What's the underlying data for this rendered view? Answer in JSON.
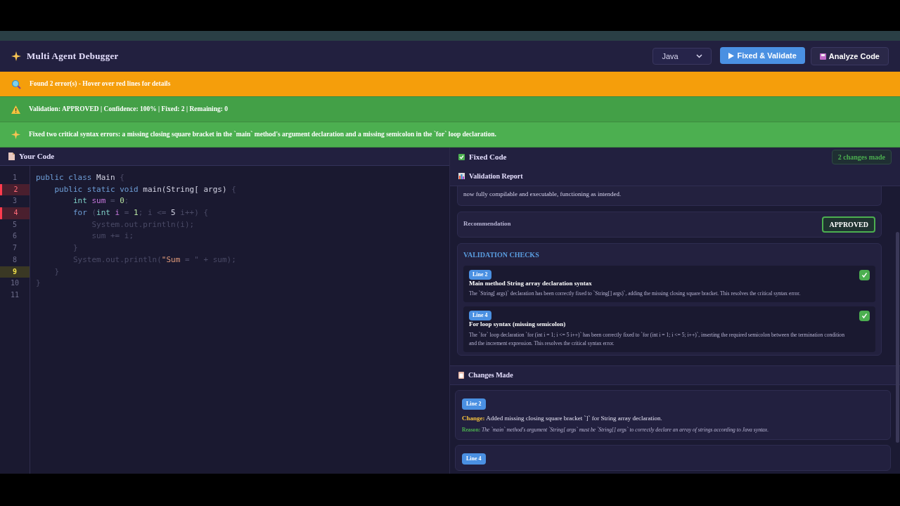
{
  "app": {
    "title": "Multi Agent Debugger"
  },
  "toolbar": {
    "language": "Java",
    "buttons": [
      {
        "kind": "primary",
        "label": "Fixed & Validate"
      },
      {
        "kind": "secondary",
        "label": "Analyze Code"
      }
    ]
  },
  "banners": [
    {
      "kind": "search",
      "color": "#f59e0b",
      "text": "Found 2 error(s) - Hover over red lines for details"
    },
    {
      "kind": "warning",
      "color": "#43a047",
      "text": "Validation: APPROVED | Confidence: 100% | Fixed: 2 | Remaining: 0"
    },
    {
      "kind": "sparkle",
      "color": "#4caf50",
      "text": "Fixed two critical syntax errors: a missing closing square bracket in the `main` method's argument declaration and a missing semicolon in the `for` loop declaration."
    }
  ],
  "editor": {
    "title": "Your Code",
    "lines": [
      {
        "number": "1",
        "error": false,
        "current": false,
        "tokens": [
          {
            "kind": "keyword",
            "text": "public class "
          },
          {
            "kind": "plain",
            "text": "Main"
          },
          {
            "kind": "dim",
            "text": " {"
          }
        ]
      },
      {
        "number": "2",
        "error": true,
        "current": false,
        "tokens": [
          {
            "kind": "keyword",
            "text": "    public static void "
          },
          {
            "kind": "plain",
            "text": "main(String[ args)"
          },
          {
            "kind": "dim",
            "text": " {"
          }
        ]
      },
      {
        "number": "3",
        "error": false,
        "current": false,
        "tokens": [
          {
            "kind": "type",
            "text": "        int "
          },
          {
            "kind": "variable",
            "text": "sum"
          },
          {
            "kind": "dim",
            "text": " = "
          },
          {
            "kind": "number",
            "text": "0"
          },
          {
            "kind": "dim",
            "text": ";"
          }
        ]
      },
      {
        "number": "4",
        "error": true,
        "current": false,
        "tokens": [
          {
            "kind": "keyword",
            "text": "        for "
          },
          {
            "kind": "dim",
            "text": "("
          },
          {
            "kind": "type",
            "text": "int "
          },
          {
            "kind": "variable",
            "text": "i"
          },
          {
            "kind": "dim",
            "text": " = "
          },
          {
            "kind": "number",
            "text": "1"
          },
          {
            "kind": "dim",
            "text": "; i <= "
          },
          {
            "kind": "plain",
            "text": "5"
          },
          {
            "kind": "dim",
            "text": " i++) {"
          }
        ]
      },
      {
        "number": "5",
        "error": false,
        "current": false,
        "tokens": [
          {
            "kind": "dim",
            "text": "            System.out.println(i);"
          }
        ]
      },
      {
        "number": "6",
        "error": false,
        "current": false,
        "tokens": [
          {
            "kind": "dim",
            "text": "            sum += i;"
          }
        ]
      },
      {
        "number": "7",
        "error": false,
        "current": false,
        "tokens": [
          {
            "kind": "dim",
            "text": "        }"
          }
        ]
      },
      {
        "number": "8",
        "error": false,
        "current": false,
        "tokens": [
          {
            "kind": "dim",
            "text": "        System.out.println("
          },
          {
            "kind": "string",
            "text": "\"Sum"
          },
          {
            "kind": "dim",
            "text": " = \" + sum);"
          }
        ]
      },
      {
        "number": "9",
        "error": false,
        "current": true,
        "tokens": [
          {
            "kind": "dim",
            "text": "    }"
          }
        ]
      },
      {
        "number": "10",
        "error": false,
        "current": false,
        "tokens": [
          {
            "kind": "dim",
            "text": "}"
          }
        ]
      },
      {
        "number": "11",
        "error": false,
        "current": false
      }
    ]
  },
  "fixed_code": {
    "title": "Fixed Code",
    "badge": "2 changes made"
  },
  "validation_report": {
    "title": "Validation Report",
    "summary": "now fully compilable and executable, functioning as intended.",
    "recommendation_label": "Recommendation",
    "recommendation": "APPROVED",
    "checks_title": "VALIDATION CHECKS",
    "checks": [
      {
        "line": "Line 2",
        "title": "Main method String array declaration syntax",
        "description": "The `String[ args)` declaration has been correctly fixed to `String[] args)`, adding the missing closing square bracket. This resolves the critical syntax error.",
        "passed": true
      },
      {
        "line": "Line 4",
        "title": "For loop syntax (missing semicolon)",
        "description": "The `for` loop declaration `for (int i = 1; i <= 5 i++)` has been correctly fixed to `for (int i = 1; i <= 5; i++)`, inserting the required semicolon between the termination condition and the increment expression. This resolves the critical syntax error.",
        "passed": true
      }
    ]
  },
  "changes": {
    "title": "Changes Made",
    "items": [
      {
        "line": "Line 2",
        "change_label": "Change:",
        "change": "Added missing closing square bracket `]` for String array declaration.",
        "reason_label": "Reason:",
        "reason": "The `main` method's argument `String[ args` must be `String[] args` to correctly declare an array of strings according to Java syntax."
      },
      {
        "line": "Line 4"
      }
    ]
  }
}
